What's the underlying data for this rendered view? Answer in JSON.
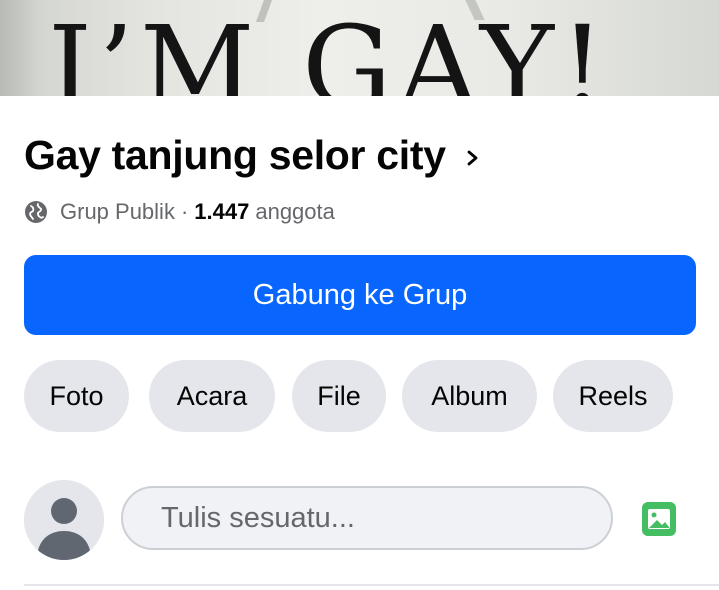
{
  "cover": {
    "text": "I’M GAY!"
  },
  "group": {
    "title": "Gay tanjung selor city",
    "privacy": "Grup Publik",
    "separator": "·",
    "member_count": "1.447",
    "member_label": "anggota"
  },
  "actions": {
    "join_label": "Gabung ke Grup"
  },
  "chips": [
    {
      "label": "Foto"
    },
    {
      "label": "Acara"
    },
    {
      "label": "File"
    },
    {
      "label": "Album"
    },
    {
      "label": "Reels"
    }
  ],
  "composer": {
    "placeholder": "Tulis sesuatu..."
  },
  "colors": {
    "primary": "#0866ff",
    "chip_bg": "#e4e6eb",
    "secondary_text": "#65676b",
    "photo_icon": "#45bd62"
  },
  "icons": {
    "privacy": "globe-icon",
    "title_chevron": "chevron-right-icon",
    "avatar": "default-avatar-icon",
    "photo": "photo-icon"
  }
}
